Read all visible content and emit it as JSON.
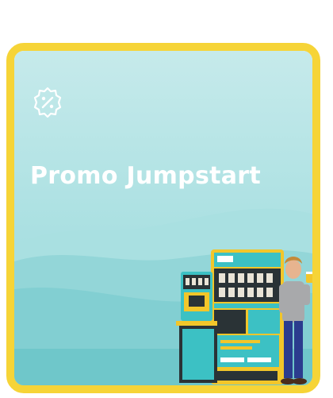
{
  "promo_card": {
    "title": "Promo Jumpstart",
    "icon": "discount-badge-icon",
    "illustration": "vending-kiosk-with-person",
    "colors": {
      "border": "#f6d437",
      "bg_top": "#c4e9ea",
      "bg_bottom": "#8ed6d8",
      "wave_dark": "#6bc6c9",
      "title": "#ffffff"
    }
  }
}
